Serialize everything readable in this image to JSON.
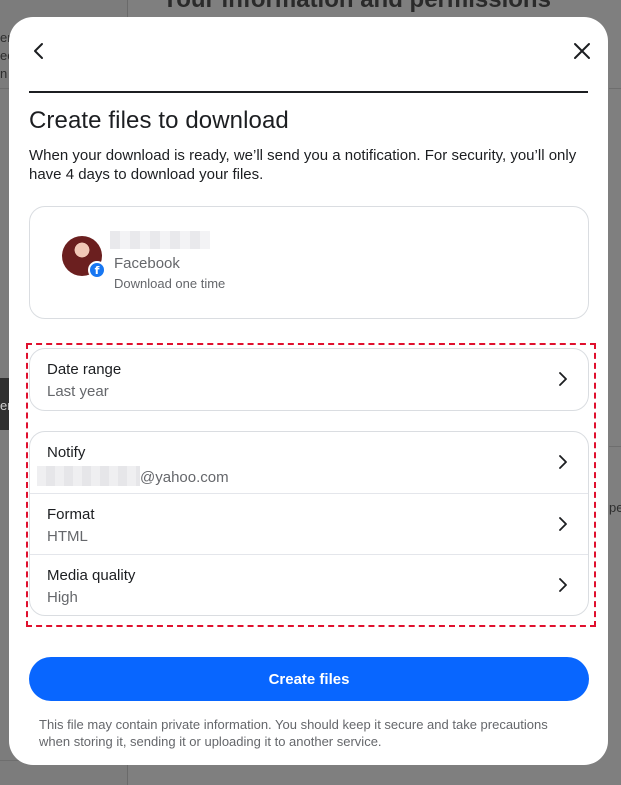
{
  "background": {
    "title": "Your information and permissions",
    "fragments": [
      "en",
      "ec",
      "n",
      "er",
      "pe"
    ]
  },
  "dialog": {
    "title": "Create files to download",
    "description": "When your download is ready, we’ll send you a notification. For security, you’ll only have 4 days to download your files.",
    "account": {
      "platform": "Facebook",
      "subtitle": "Download one time"
    },
    "settings": {
      "date_range": {
        "label": "Date range",
        "value": "Last year"
      },
      "notify": {
        "label": "Notify",
        "email_domain": "@yahoo.com"
      },
      "format": {
        "label": "Format",
        "value": "HTML"
      },
      "media_quality": {
        "label": "Media quality",
        "value": "High"
      }
    },
    "primary_button": "Create files",
    "disclaimer": "This file may contain private information. You should keep it secure and take precautions when storing it, sending it or uploading it to another service."
  },
  "colors": {
    "primary": "#0866ff",
    "highlight": "#e0102e",
    "facebook": "#1877f2"
  },
  "icons": [
    "back-arrow-icon",
    "close-icon",
    "facebook-logo-icon",
    "chevron-right-icon"
  ]
}
